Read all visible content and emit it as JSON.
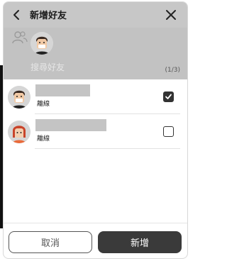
{
  "header": {
    "title": "新增好友",
    "back_icon": "chevron-left-icon",
    "close_icon": "close-icon"
  },
  "selection": {
    "friends_icon": "friends-icon",
    "search_placeholder": "搜尋好友",
    "count": "(1/3)"
  },
  "friends": [
    {
      "status": "離線",
      "checked": true,
      "avatar": "avatar-dark-hair"
    },
    {
      "status": "離線",
      "checked": false,
      "avatar": "avatar-red-hair"
    }
  ],
  "footer": {
    "cancel_label": "取消",
    "add_label": "新增"
  },
  "colors": {
    "header_bg": "#c7c7c7",
    "primary_button": "#3a3a3a"
  }
}
